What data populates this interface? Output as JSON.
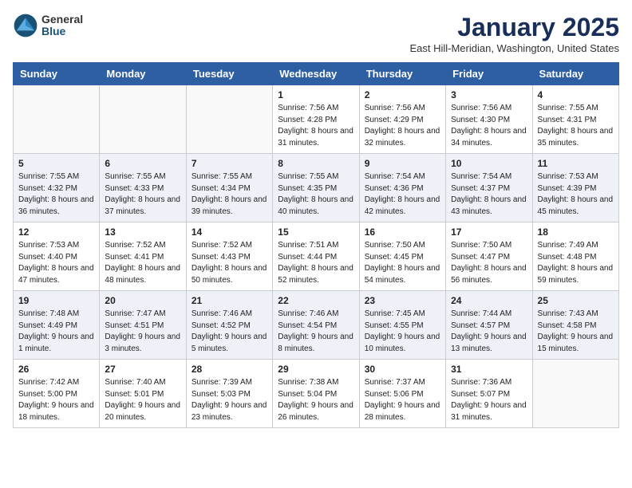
{
  "header": {
    "logo_general": "General",
    "logo_blue": "Blue",
    "title": "January 2025",
    "location": "East Hill-Meridian, Washington, United States"
  },
  "weekdays": [
    "Sunday",
    "Monday",
    "Tuesday",
    "Wednesday",
    "Thursday",
    "Friday",
    "Saturday"
  ],
  "weeks": [
    [
      {
        "day": "",
        "info": ""
      },
      {
        "day": "",
        "info": ""
      },
      {
        "day": "",
        "info": ""
      },
      {
        "day": "1",
        "info": "Sunrise: 7:56 AM\nSunset: 4:28 PM\nDaylight: 8 hours and 31 minutes."
      },
      {
        "day": "2",
        "info": "Sunrise: 7:56 AM\nSunset: 4:29 PM\nDaylight: 8 hours and 32 minutes."
      },
      {
        "day": "3",
        "info": "Sunrise: 7:56 AM\nSunset: 4:30 PM\nDaylight: 8 hours and 34 minutes."
      },
      {
        "day": "4",
        "info": "Sunrise: 7:55 AM\nSunset: 4:31 PM\nDaylight: 8 hours and 35 minutes."
      }
    ],
    [
      {
        "day": "5",
        "info": "Sunrise: 7:55 AM\nSunset: 4:32 PM\nDaylight: 8 hours and 36 minutes."
      },
      {
        "day": "6",
        "info": "Sunrise: 7:55 AM\nSunset: 4:33 PM\nDaylight: 8 hours and 37 minutes."
      },
      {
        "day": "7",
        "info": "Sunrise: 7:55 AM\nSunset: 4:34 PM\nDaylight: 8 hours and 39 minutes."
      },
      {
        "day": "8",
        "info": "Sunrise: 7:55 AM\nSunset: 4:35 PM\nDaylight: 8 hours and 40 minutes."
      },
      {
        "day": "9",
        "info": "Sunrise: 7:54 AM\nSunset: 4:36 PM\nDaylight: 8 hours and 42 minutes."
      },
      {
        "day": "10",
        "info": "Sunrise: 7:54 AM\nSunset: 4:37 PM\nDaylight: 8 hours and 43 minutes."
      },
      {
        "day": "11",
        "info": "Sunrise: 7:53 AM\nSunset: 4:39 PM\nDaylight: 8 hours and 45 minutes."
      }
    ],
    [
      {
        "day": "12",
        "info": "Sunrise: 7:53 AM\nSunset: 4:40 PM\nDaylight: 8 hours and 47 minutes."
      },
      {
        "day": "13",
        "info": "Sunrise: 7:52 AM\nSunset: 4:41 PM\nDaylight: 8 hours and 48 minutes."
      },
      {
        "day": "14",
        "info": "Sunrise: 7:52 AM\nSunset: 4:43 PM\nDaylight: 8 hours and 50 minutes."
      },
      {
        "day": "15",
        "info": "Sunrise: 7:51 AM\nSunset: 4:44 PM\nDaylight: 8 hours and 52 minutes."
      },
      {
        "day": "16",
        "info": "Sunrise: 7:50 AM\nSunset: 4:45 PM\nDaylight: 8 hours and 54 minutes."
      },
      {
        "day": "17",
        "info": "Sunrise: 7:50 AM\nSunset: 4:47 PM\nDaylight: 8 hours and 56 minutes."
      },
      {
        "day": "18",
        "info": "Sunrise: 7:49 AM\nSunset: 4:48 PM\nDaylight: 8 hours and 59 minutes."
      }
    ],
    [
      {
        "day": "19",
        "info": "Sunrise: 7:48 AM\nSunset: 4:49 PM\nDaylight: 9 hours and 1 minute."
      },
      {
        "day": "20",
        "info": "Sunrise: 7:47 AM\nSunset: 4:51 PM\nDaylight: 9 hours and 3 minutes."
      },
      {
        "day": "21",
        "info": "Sunrise: 7:46 AM\nSunset: 4:52 PM\nDaylight: 9 hours and 5 minutes."
      },
      {
        "day": "22",
        "info": "Sunrise: 7:46 AM\nSunset: 4:54 PM\nDaylight: 9 hours and 8 minutes."
      },
      {
        "day": "23",
        "info": "Sunrise: 7:45 AM\nSunset: 4:55 PM\nDaylight: 9 hours and 10 minutes."
      },
      {
        "day": "24",
        "info": "Sunrise: 7:44 AM\nSunset: 4:57 PM\nDaylight: 9 hours and 13 minutes."
      },
      {
        "day": "25",
        "info": "Sunrise: 7:43 AM\nSunset: 4:58 PM\nDaylight: 9 hours and 15 minutes."
      }
    ],
    [
      {
        "day": "26",
        "info": "Sunrise: 7:42 AM\nSunset: 5:00 PM\nDaylight: 9 hours and 18 minutes."
      },
      {
        "day": "27",
        "info": "Sunrise: 7:40 AM\nSunset: 5:01 PM\nDaylight: 9 hours and 20 minutes."
      },
      {
        "day": "28",
        "info": "Sunrise: 7:39 AM\nSunset: 5:03 PM\nDaylight: 9 hours and 23 minutes."
      },
      {
        "day": "29",
        "info": "Sunrise: 7:38 AM\nSunset: 5:04 PM\nDaylight: 9 hours and 26 minutes."
      },
      {
        "day": "30",
        "info": "Sunrise: 7:37 AM\nSunset: 5:06 PM\nDaylight: 9 hours and 28 minutes."
      },
      {
        "day": "31",
        "info": "Sunrise: 7:36 AM\nSunset: 5:07 PM\nDaylight: 9 hours and 31 minutes."
      },
      {
        "day": "",
        "info": ""
      }
    ]
  ]
}
